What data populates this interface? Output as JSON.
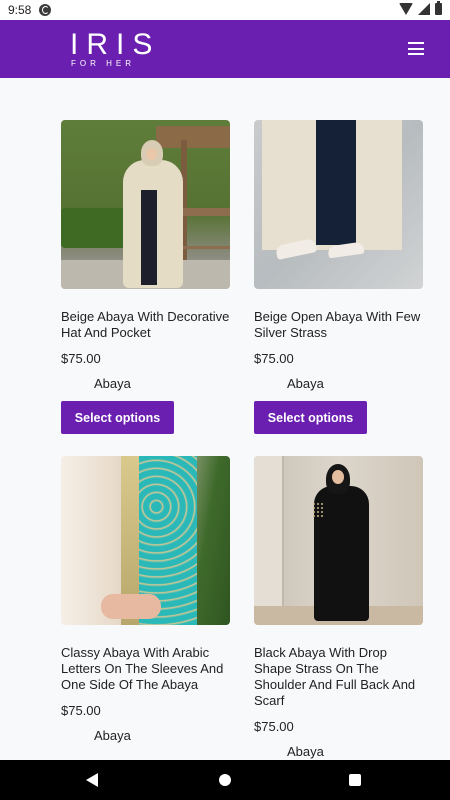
{
  "status_bar": {
    "time": "9:58"
  },
  "header": {
    "logo_main": "IRIS",
    "logo_sub": "FOR HER"
  },
  "products": [
    {
      "title": "Beige Abaya With Decorative Hat And Pocket",
      "price": "$75.00",
      "category": "Abaya",
      "button_label": "Select options"
    },
    {
      "title": "Beige Open Abaya With Few Silver Strass",
      "price": "$75.00",
      "category": "Abaya",
      "button_label": "Select options"
    },
    {
      "title": "Classy Abaya With Arabic Letters On The Sleeves And One Side Of The Abaya",
      "price": "$75.00",
      "category": "Abaya"
    },
    {
      "title": "Black Abaya With Drop Shape Strass On The Shoulder And Full Back And Scarf",
      "price": "$75.00",
      "category": "Abaya"
    }
  ],
  "colors": {
    "brand": "#6a1fb1",
    "background": "#f8f9fb"
  }
}
